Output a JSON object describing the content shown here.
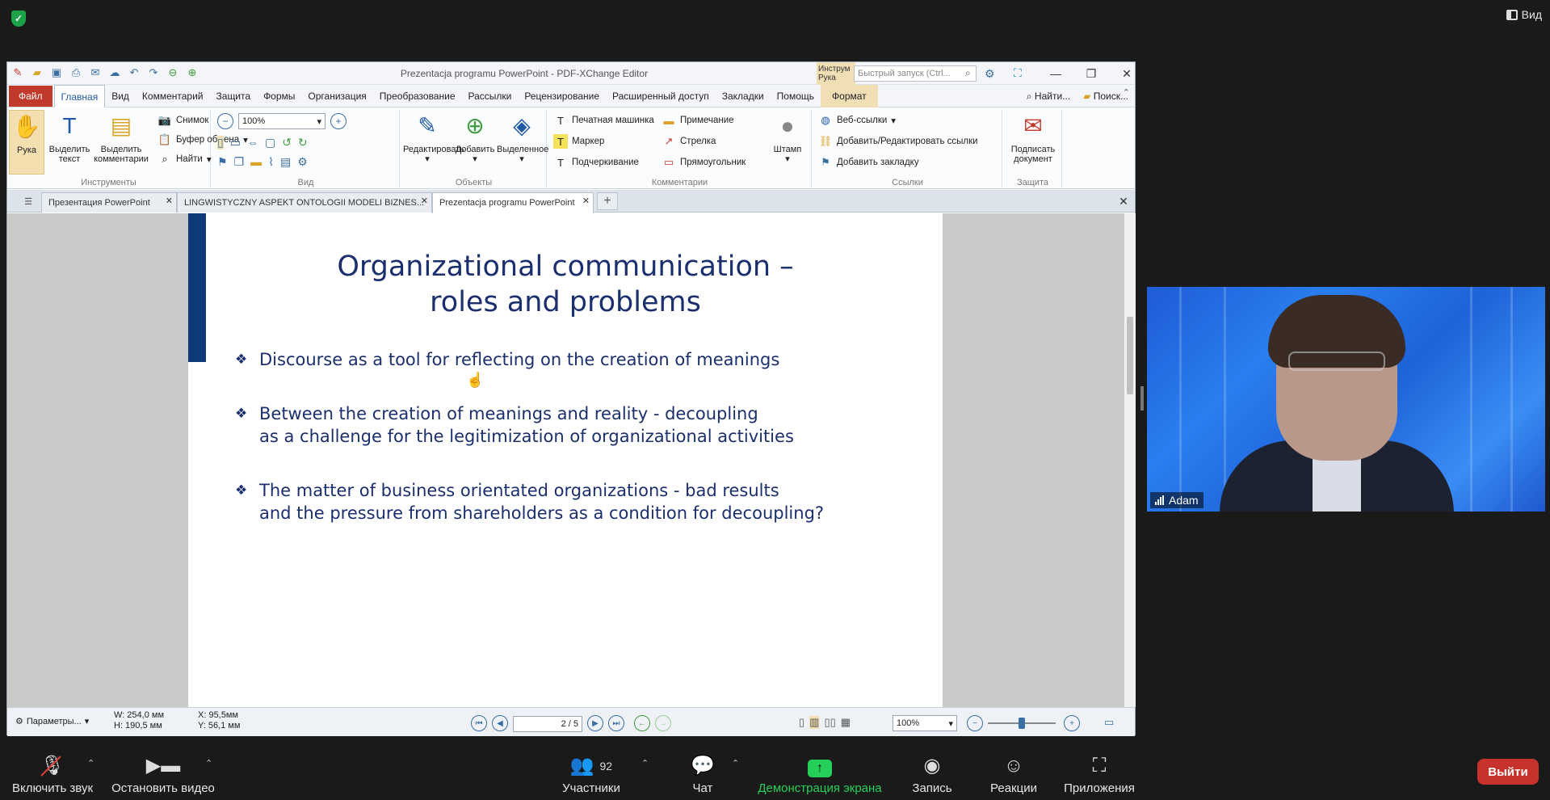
{
  "zoom": {
    "view_label": "Вид",
    "participants_count": "92",
    "toolbar": {
      "unmute": "Включить звук",
      "stop_video": "Остановить видео",
      "participants": "Участники",
      "chat": "Чат",
      "share": "Демонстрация экрана",
      "record": "Запись",
      "reactions": "Реакции",
      "apps": "Приложения",
      "leave": "Выйти"
    },
    "video_name": "Adam"
  },
  "editor": {
    "title": "Prezentacja programu PowerPoint - PDF-XChange Editor",
    "instr_tab": "Инструм Рука",
    "quick_search_placeholder": "Быстрый запуск (Ctrl...",
    "menu": {
      "file": "Файл",
      "items": [
        "Главная",
        "Вид",
        "Комментарий",
        "Защита",
        "Формы",
        "Организация",
        "Преобразование",
        "Рассылки",
        "Рецензирование",
        "Расширенный доступ",
        "Закладки",
        "Помощь"
      ],
      "format": "Формат",
      "find": "Найти...",
      "search": "Поиск..."
    },
    "ribbon": {
      "tools": {
        "label": "Инструменты",
        "hand": "Рука",
        "select_text": "Выделить текст",
        "select_comments": "Выделить комментарии",
        "snapshot": "Снимок",
        "clipboard": "Буфер обмена",
        "find": "Найти"
      },
      "view": {
        "label": "Вид",
        "zoom": "100%"
      },
      "objects": {
        "label": "Объекты",
        "edit": "Редактировать",
        "add": "Добавить",
        "selected": "Выделенное"
      },
      "comments": {
        "label": "Комментарии",
        "typewriter": "Печатная машинка",
        "note": "Примечание",
        "marker": "Маркер",
        "arrow": "Стрелка",
        "underline": "Подчеркивание",
        "rectangle": "Прямоугольник",
        "stamp": "Штамп"
      },
      "links": {
        "label": "Ссылки",
        "web_links": "Веб-ссылки",
        "add_edit_links": "Добавить/Редактировать ссылки",
        "add_bookmark": "Добавить закладку"
      },
      "protect": {
        "label": "Защита",
        "sign": "Подписать документ"
      }
    },
    "tabs": [
      {
        "label": "Презентация PowerPoint"
      },
      {
        "label": "LINGWISTYCZNY ASPEKT ONTOLOGII MODELI BIZNES..."
      },
      {
        "label": "Prezentacja programu PowerPoint"
      }
    ],
    "slide": {
      "title_line1": "Organizational communication –",
      "title_line2": "roles and problems",
      "bullets": [
        {
          "l1": "Discourse as a tool for reflecting on the creation of meanings",
          "l2": ""
        },
        {
          "l1": "Between the creation of meanings and reality - decoupling",
          "l2": "as a challenge for the legitimization of organizational activities"
        },
        {
          "l1": "The matter of business orientated organizations - bad results",
          "l2": "and the pressure from shareholders as a condition for decoupling?"
        }
      ]
    },
    "status": {
      "params": "Параметры...",
      "w": "W: 254,0 мм",
      "h": "H: 190,5 мм",
      "x": "X:    95,5мм",
      "y": "Y:    56,1 мм",
      "page": "2 / 5",
      "zoom": "100%"
    }
  }
}
